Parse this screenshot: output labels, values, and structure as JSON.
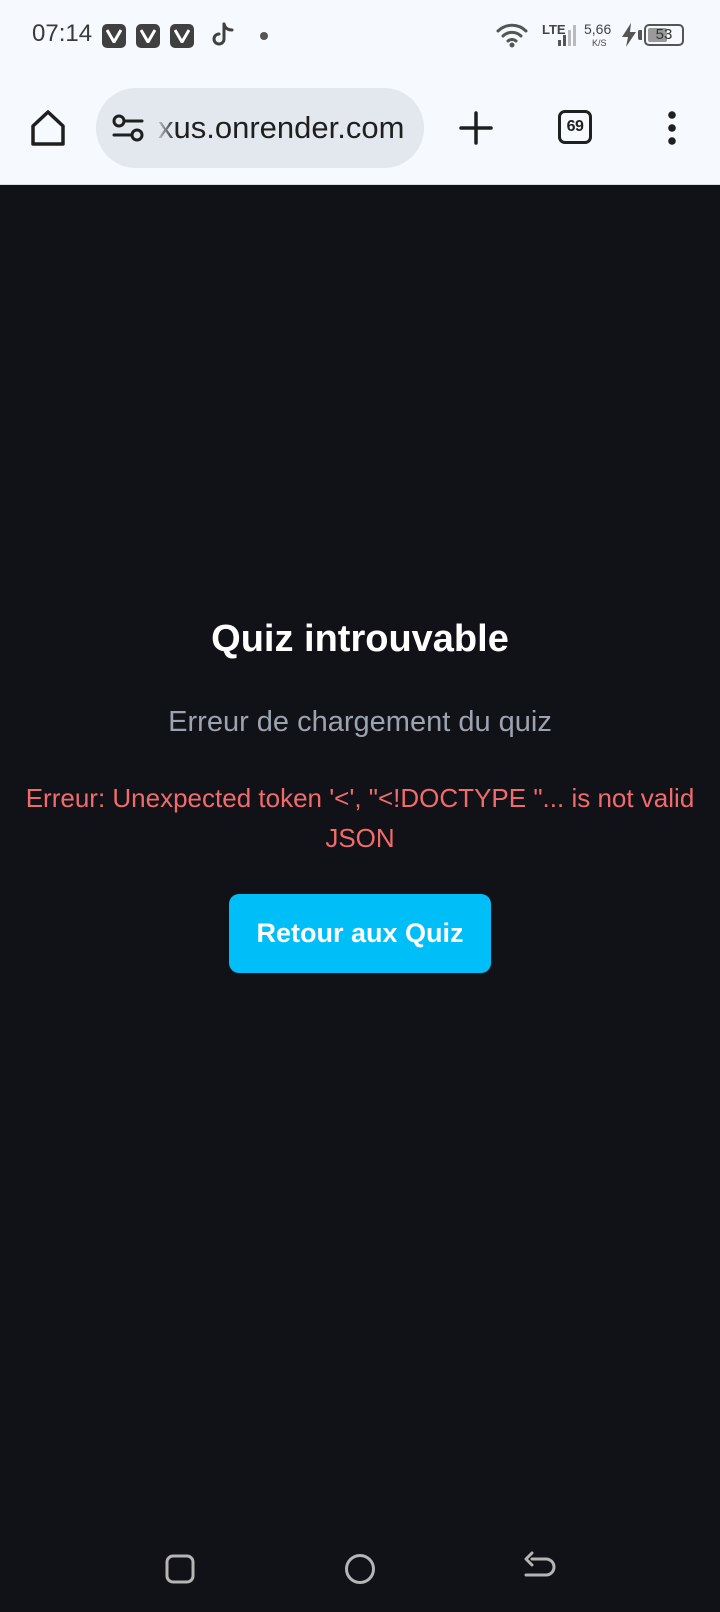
{
  "status_bar": {
    "time": "07:14",
    "notification_icons": [
      "v-app-icon",
      "v-app-icon",
      "v-app-icon",
      "tiktok-icon",
      "dot-icon"
    ],
    "network_type": "LTE",
    "speed_value": "5,66",
    "speed_unit": "K/S",
    "battery_level": "53"
  },
  "toolbar": {
    "url": "xus.onrender.com",
    "tab_count": "69"
  },
  "main": {
    "title": "Quiz introuvable",
    "subtitle": "Erreur de chargement du quiz",
    "error_message": "Erreur: Unexpected token '<', \"<!DOCTYPE \"... is not valid JSON",
    "back_button_label": "Retour aux Quiz"
  },
  "colors": {
    "page_background": "#111118",
    "browser_chrome": "#f6f9fd",
    "error_text": "#f26b6b",
    "button_accent": "#00bef7",
    "subtitle_text": "#9ca3af"
  },
  "nav_icons": [
    "recents-icon",
    "home-circle-icon",
    "back-icon"
  ]
}
